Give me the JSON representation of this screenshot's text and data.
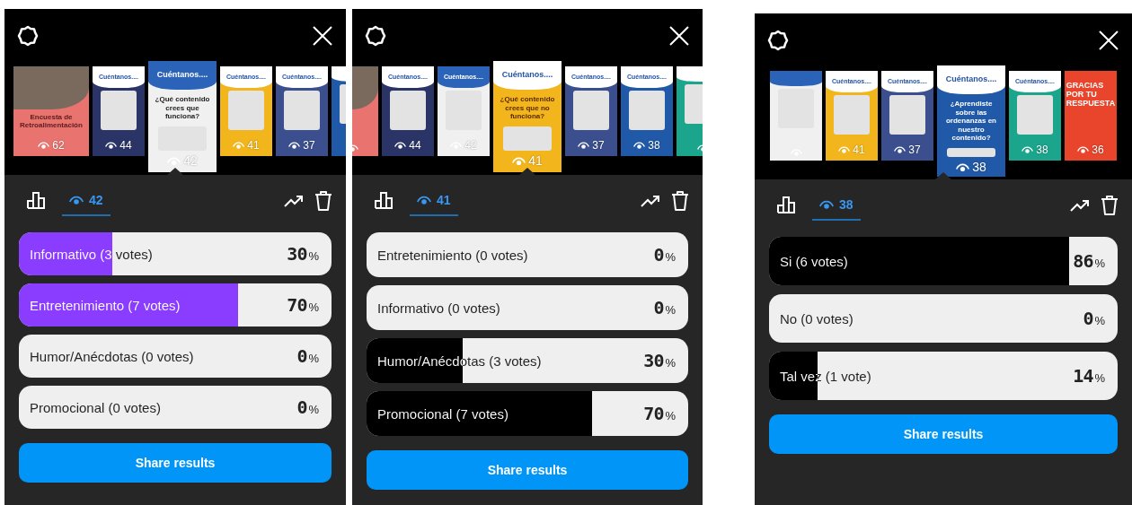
{
  "panels": [
    {
      "color": "#8b3dff",
      "thumbnails": [
        {
          "kind": "cover",
          "color": "#e8736f",
          "title": "Encuesta de Retroalimentación",
          "views": "62",
          "selected": false
        },
        {
          "kind": "story",
          "color": "#2b3467",
          "title": "Cuéntanos....",
          "views": "44",
          "selected": false
        },
        {
          "kind": "story",
          "color": "#f0f0f0",
          "title": "Cuéntanos....",
          "question": "¿Qué contenido crees que funciona?",
          "views": "42",
          "selected": true
        },
        {
          "kind": "story",
          "color": "#f2b51c",
          "title": "Cuéntanos....",
          "views": "41",
          "selected": false
        },
        {
          "kind": "story",
          "color": "#3b4f8f",
          "title": "Cuéntanos....",
          "views": "37",
          "selected": false
        },
        {
          "kind": "story",
          "color": "#2059a8",
          "selected": false
        }
      ],
      "tabs": [
        {
          "kind": "chart",
          "selected": false
        },
        {
          "kind": "views",
          "label": "42",
          "selected": true
        }
      ],
      "options": [
        {
          "label": "Informativo (3 votes)",
          "level": 0.3,
          "value": "30",
          "unit": "%"
        },
        {
          "label": "Entretenimiento (7 votes)",
          "level": 0.7,
          "value": "70",
          "unit": "%"
        },
        {
          "label": "Humor/Anécdotas (0 votes)",
          "level": 0,
          "value": "0",
          "unit": "%"
        },
        {
          "label": "Promocional (0 votes)",
          "level": 0,
          "value": "0",
          "unit": "%"
        }
      ],
      "share_button": "Share results"
    },
    {
      "color": "#000000",
      "thumbnails": [
        {
          "kind": "cover",
          "color": "#e8736f",
          "selected": false
        },
        {
          "kind": "story",
          "color": "#2b3467",
          "title": "Cuéntanos....",
          "views": "44",
          "selected": false
        },
        {
          "kind": "story",
          "color": "#f0f0f0",
          "title": "Cuéntanos....",
          "views": "42",
          "selected": false
        },
        {
          "kind": "story",
          "color": "#f2b51c",
          "title": "Cuéntanos....",
          "question": "¿Qué contenido crees que no funciona?",
          "views": "41",
          "selected": true
        },
        {
          "kind": "story",
          "color": "#3b4f8f",
          "title": "Cuéntanos....",
          "views": "37",
          "selected": false
        },
        {
          "kind": "story",
          "color": "#2059a8",
          "title": "Cuéntanos....",
          "views": "38",
          "selected": false
        },
        {
          "kind": "story",
          "color": "#1aa58c",
          "selected": false
        }
      ],
      "tabs": [
        {
          "kind": "chart",
          "selected": false
        },
        {
          "kind": "views",
          "label": "41",
          "selected": true
        }
      ],
      "options": [
        {
          "label": "Entretenimiento (0 votes)",
          "level": 0,
          "value": "0",
          "unit": "%"
        },
        {
          "label": "Informativo (0 votes)",
          "level": 0,
          "value": "0",
          "unit": "%"
        },
        {
          "label": "Humor/Anécdotas (3 votes)",
          "level": 0.3,
          "value": "30",
          "unit": "%"
        },
        {
          "label": "Promocional (7 votes)",
          "level": 0.7,
          "value": "70",
          "unit": "%"
        }
      ],
      "share_button": "Share results"
    },
    {
      "color": "#000000",
      "thumbnails": [
        {
          "kind": "story",
          "color": "#f0f0f0",
          "selected": false
        },
        {
          "kind": "story",
          "color": "#f2b51c",
          "title": "Cuéntanos....",
          "views": "41",
          "selected": false
        },
        {
          "kind": "story",
          "color": "#3b4f8f",
          "title": "Cuéntanos....",
          "views": "37",
          "selected": false
        },
        {
          "kind": "story",
          "color": "#2059a8",
          "title": "Cuéntanos....",
          "question": "¿Aprendiste sobre las ordenanzas en nuestro contenido?",
          "views": "38",
          "selected": true
        },
        {
          "kind": "story",
          "color": "#1aa58c",
          "title": "Cuéntanos....",
          "views": "38",
          "selected": false
        },
        {
          "kind": "thanks",
          "color": "#e8452c",
          "title": "GRACIAS POR TU RESPUESTA",
          "views": "36",
          "selected": false
        }
      ],
      "tabs": [
        {
          "kind": "chart",
          "selected": false
        },
        {
          "kind": "views",
          "label": "38",
          "selected": true
        }
      ],
      "options": [
        {
          "label": "Si (6 votes)",
          "level": 0.86,
          "value": "86",
          "unit": "%"
        },
        {
          "label": "No (0 votes)",
          "level": 0,
          "value": "0",
          "unit": "%"
        },
        {
          "label": "Tal vez (1 vote)",
          "level": 0.14,
          "value": "14",
          "unit": "%"
        }
      ],
      "share_button": "Share results"
    }
  ]
}
